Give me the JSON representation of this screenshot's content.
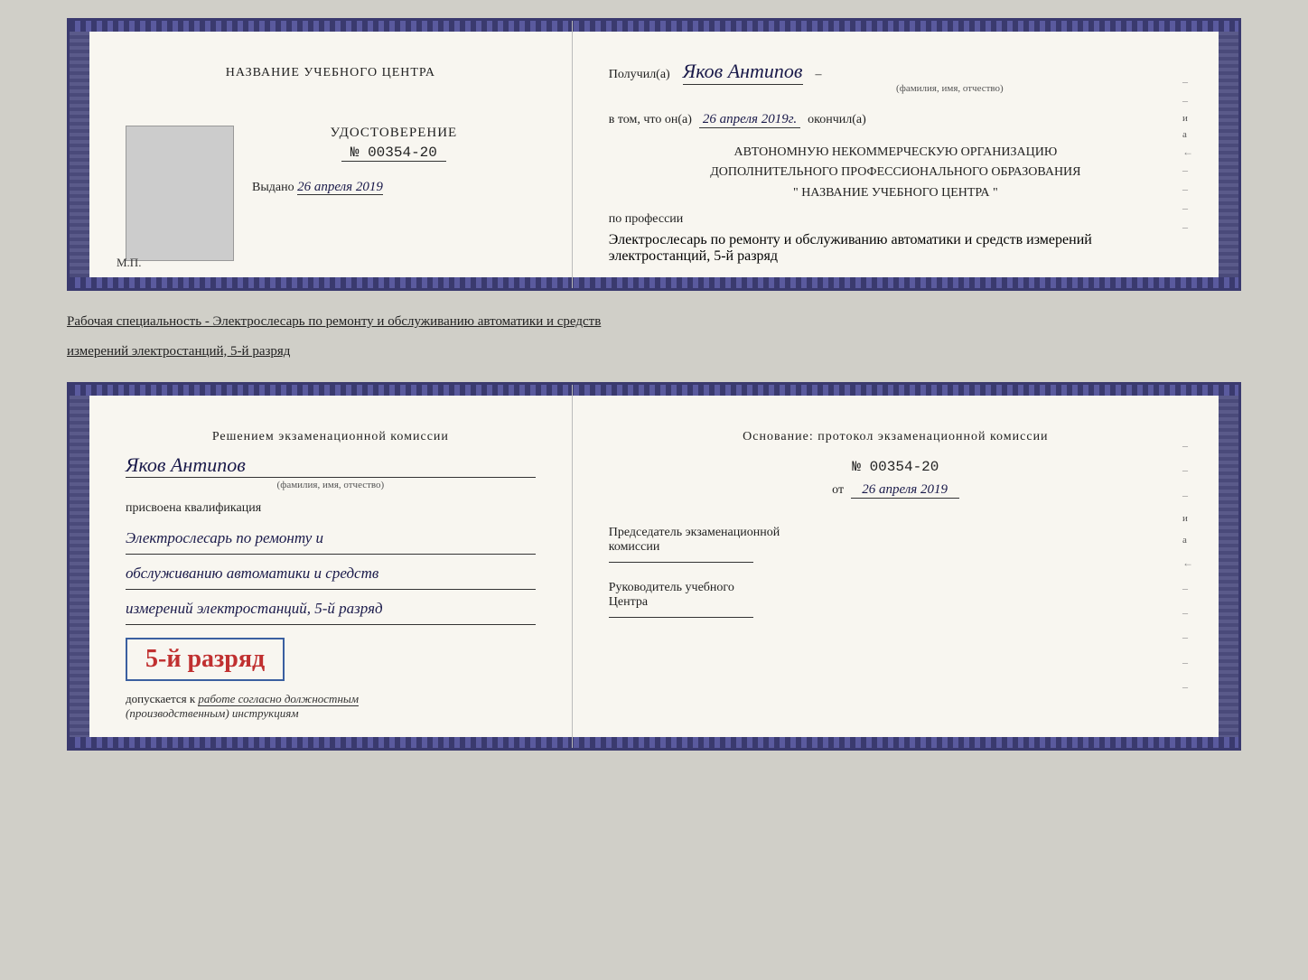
{
  "top_cert": {
    "left": {
      "center_title": "НАЗВАНИЕ УЧЕБНОГО ЦЕНТРА",
      "udost_title": "УДОСТОВЕРЕНИЕ",
      "udost_number": "№ 00354-20",
      "vydano_label": "Выдано",
      "vydano_date": "26 апреля 2019",
      "mp_label": "М.П."
    },
    "right": {
      "poluchil_label": "Получил(а)",
      "recipient_name": "Яков Антипов",
      "fio_sublabel": "(фамилия, имя, отчество)",
      "vtom_label": "в том, что он(а)",
      "date_handwritten": "26 апреля 2019г.",
      "okonchil_label": "окончил(а)",
      "org_line1": "АВТОНОМНУЮ НЕКОММЕРЧЕСКУЮ ОРГАНИЗАЦИЮ",
      "org_line2": "ДОПОЛНИТЕЛЬНОГО ПРОФЕССИОНАЛЬНОГО ОБРАЗОВАНИЯ",
      "org_line3": "\"  НАЗВАНИЕ УЧЕБНОГО ЦЕНТРА   \"",
      "po_professii_label": "по профессии",
      "profession_line1": "Электрослесарь по ремонту и",
      "profession_line2": "обслуживанию автоматики и средств",
      "profession_line3": "измерений электростанций, 5-й разряд"
    }
  },
  "middle": {
    "text": "Рабочая специальность - Электрослесарь по ремонту и обслуживанию автоматики и средств",
    "text2": "измерений электростанций, 5-й разряд"
  },
  "bottom_cert": {
    "left": {
      "decision_title": "Решением экзаменационной комиссии",
      "person_name": "Яков Антипов",
      "fio_sublabel": "(фамилия, имя, отчество)",
      "prisvoena_label": "присвоена квалификация",
      "qual_line1": "Электрослесарь по ремонту и",
      "qual_line2": "обслуживанию автоматики и средств",
      "qual_line3": "измерений электростанций, 5-й разряд",
      "grade_text": "5-й разряд",
      "dopuskaetsya_label": "допускается к",
      "work_text": "работе согласно должностным",
      "instr_text": "(производственным) инструкциям"
    },
    "right": {
      "osnov_title": "Основание: протокол экзаменационной комиссии",
      "number_label": "№ 00354-20",
      "ot_label": "от",
      "date_text": "26 апреля 2019",
      "chairman_title": "Председатель экзаменационной",
      "chairman_title2": "комиссии",
      "director_title": "Руководитель учебного",
      "director_title2": "Центра"
    }
  }
}
